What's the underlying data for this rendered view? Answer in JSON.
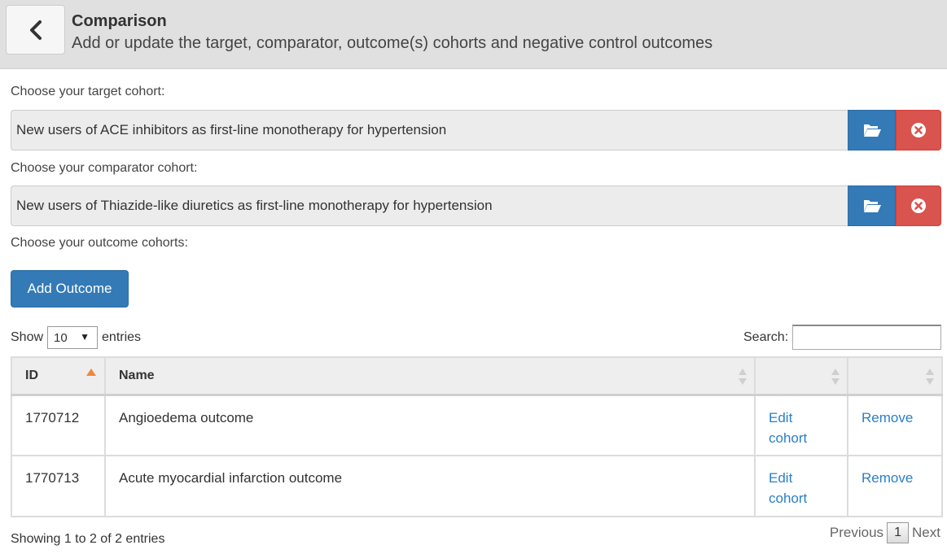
{
  "header": {
    "title": "Comparison",
    "subtitle": "Add or update the target, comparator, outcome(s) cohorts and negative control outcomes"
  },
  "target": {
    "label": "Choose your target cohort:",
    "value": "New users of ACE inhibitors as first-line monotherapy for hypertension"
  },
  "comparator": {
    "label": "Choose your comparator cohort:",
    "value": "New users of Thiazide-like diuretics as first-line monotherapy for hypertension"
  },
  "outcomes": {
    "label": "Choose your outcome cohorts:",
    "add_button": "Add Outcome"
  },
  "table_controls": {
    "show_prefix": "Show",
    "page_size": "10",
    "show_suffix": "entries",
    "search_label": "Search:",
    "search_value": ""
  },
  "table": {
    "columns": [
      "ID",
      "Name",
      "",
      ""
    ],
    "rows": [
      {
        "id": "1770712",
        "name": "Angioedema outcome",
        "edit": "Edit cohort",
        "remove": "Remove"
      },
      {
        "id": "1770713",
        "name": "Acute myocardial infarction outcome",
        "edit": "Edit cohort",
        "remove": "Remove"
      }
    ]
  },
  "footer": {
    "info": "Showing 1 to 2 of 2 entries",
    "previous": "Previous",
    "page": "1",
    "next": "Next"
  },
  "colors": {
    "primary": "#337ab7",
    "danger": "#d9534f",
    "link": "#2a7fc9",
    "sort_active": "#f0883a"
  },
  "icons": {
    "back": "chevron-left-icon",
    "open": "folder-open-icon",
    "clear": "times-circle-icon"
  }
}
